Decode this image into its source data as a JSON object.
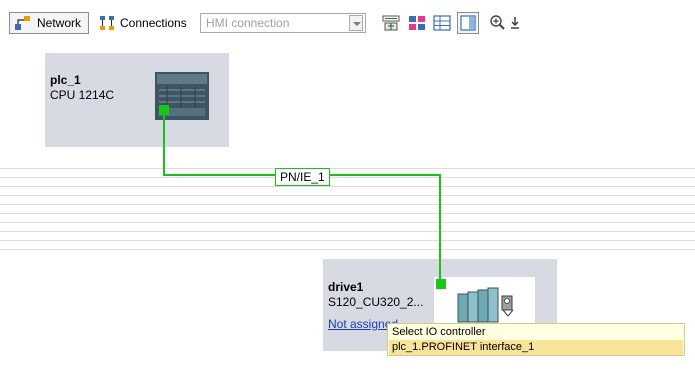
{
  "toolbar": {
    "network_label": "Network",
    "connections_label": "Connections",
    "connection_type": "HMI connection",
    "colors": {
      "pressed_border": "#8c8c8c",
      "disabled_text": "#a0a0a0"
    }
  },
  "devices": [
    {
      "name": "plc_1",
      "type": "CPU 1214C",
      "icon": "plc-device-icon"
    },
    {
      "name": "drive1",
      "type": "S120_CU320_2...",
      "assignment": "Not assigned",
      "icon": "drive-device-icon"
    }
  ],
  "network": {
    "subnet_label": "PN/IE_1",
    "colors": {
      "wire": "#19c219",
      "port": "#15c915",
      "device_bg": "#d7d9e3"
    }
  },
  "tooltip": {
    "title": "Select IO controller",
    "items": [
      "plc_1.PROFINET interface_1"
    ]
  }
}
